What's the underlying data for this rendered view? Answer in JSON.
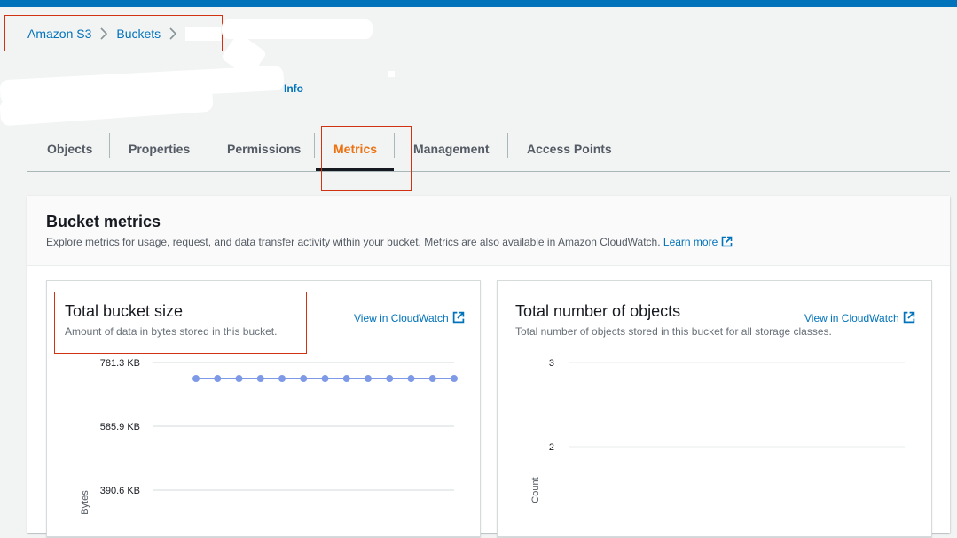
{
  "breadcrumb": {
    "items": [
      {
        "label": "Amazon S3"
      },
      {
        "label": "Buckets"
      }
    ]
  },
  "header": {
    "info_label": "Info"
  },
  "tabs": [
    {
      "label": "Objects",
      "active": false
    },
    {
      "label": "Properties",
      "active": false
    },
    {
      "label": "Permissions",
      "active": false
    },
    {
      "label": "Metrics",
      "active": true
    },
    {
      "label": "Management",
      "active": false
    },
    {
      "label": "Access Points",
      "active": false
    }
  ],
  "bucket_metrics": {
    "title": "Bucket metrics",
    "description": "Explore metrics for usage, request, and data transfer activity within your bucket. Metrics are also available in Amazon CloudWatch.",
    "learn_more": "Learn more"
  },
  "cards": [
    {
      "title": "Total bucket size",
      "description": "Amount of data in bytes stored in this bucket.",
      "cloudwatch_link": "View in CloudWatch"
    },
    {
      "title": "Total number of objects",
      "description": "Total number of objects stored in this bucket for all storage classes.",
      "cloudwatch_link": "View in CloudWatch"
    }
  ],
  "colors": {
    "accent": "#0073bb",
    "active_tab": "#ec7211",
    "highlight_box": "#d13212",
    "series": "#7e9ae6"
  },
  "chart_data": [
    {
      "type": "line",
      "ylabel": "Bytes",
      "y_ticks": [
        "781.3 KB",
        "585.9 KB",
        "390.6 KB"
      ],
      "y_tick_values": [
        781.3,
        585.9,
        390.6
      ],
      "ylim_visible": [
        390.6,
        781.3
      ],
      "grid": true,
      "series": [
        {
          "values": [
            732.4,
            732.4,
            732.4,
            732.4,
            732.4,
            732.4,
            732.4,
            732.4,
            732.4,
            732.4,
            732.4,
            732.4,
            732.4
          ]
        }
      ]
    },
    {
      "type": "line",
      "ylabel": "Count",
      "y_ticks": [
        "3",
        "2"
      ],
      "y_tick_values": [
        3,
        2
      ],
      "grid": true,
      "series": []
    }
  ]
}
